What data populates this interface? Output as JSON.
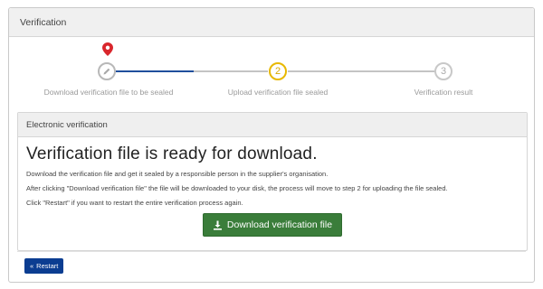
{
  "window": {
    "title": "Verification"
  },
  "stepper": {
    "active_color": "#1f4e9c",
    "current_color": "#e8b800",
    "steps": [
      {
        "number": "",
        "icon": "pencil-icon",
        "label": "Download verification file to be sealed"
      },
      {
        "number": "2",
        "label": "Upload verification file sealed"
      },
      {
        "number": "3",
        "label": "Verification result"
      }
    ],
    "marker_icon": "map-pin-icon",
    "marker_color": "#d9262c"
  },
  "panel": {
    "title": "Electronic verification",
    "heading": "Verification file is ready for download.",
    "paragraphs": [
      "Download the verification file and get it sealed by a responsible person in the supplier's organisation.",
      "After clicking \"Download verification file\" the file will be downloaded to your disk, the process will move to step 2 for uploading the file sealed.",
      "Click \"Restart\" if you want to restart the entire verification process again."
    ],
    "download_button": {
      "label": "Download verification file",
      "icon": "download-icon",
      "color": "#3a7d3a"
    }
  },
  "footer": {
    "restart_button": {
      "label": "Restart",
      "icon": "double-chevron-left-icon",
      "color": "#0b3d91"
    }
  }
}
